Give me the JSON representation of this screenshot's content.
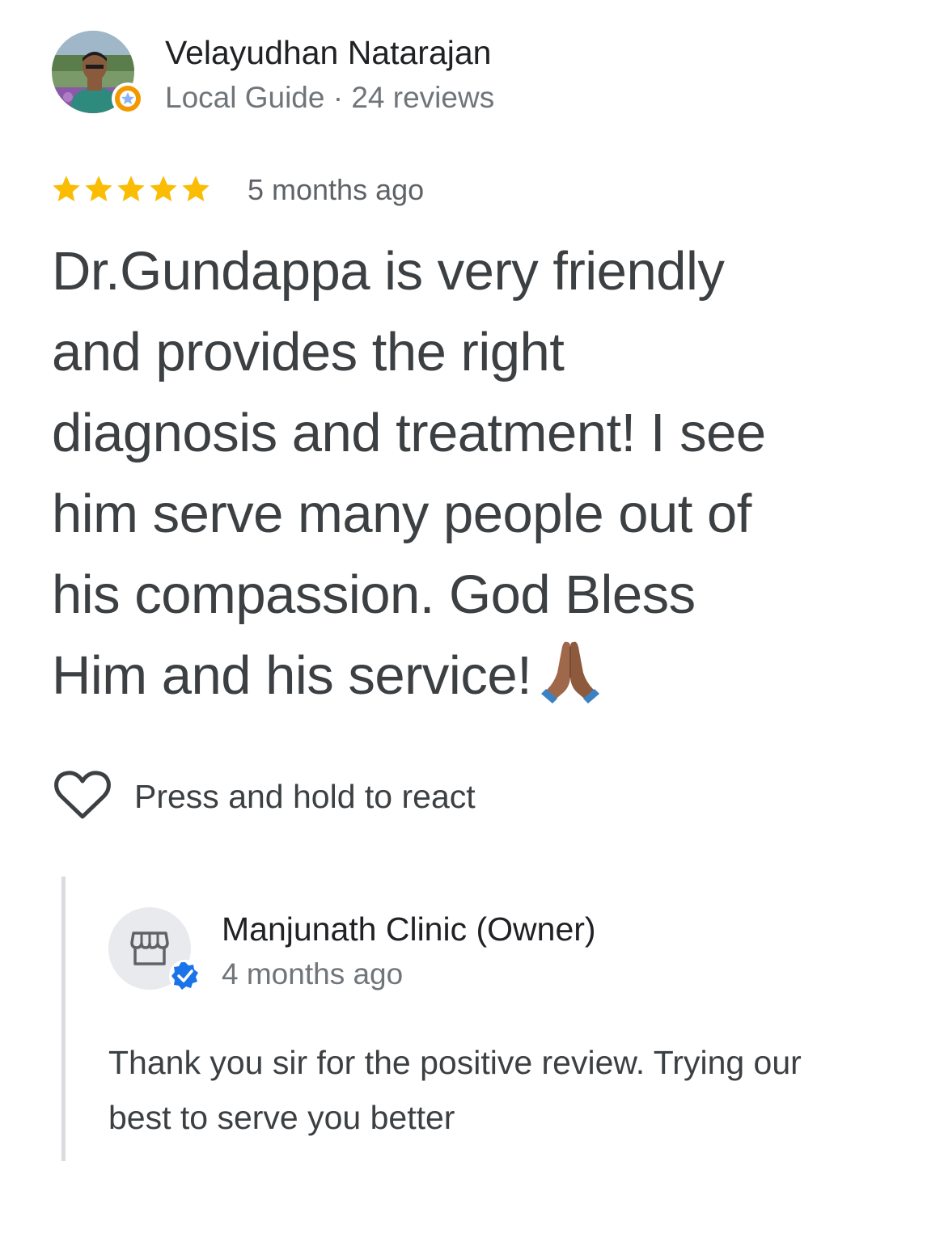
{
  "reviewer": {
    "name": "Velayudhan Natarajan",
    "meta": "Local Guide · 24 reviews"
  },
  "review": {
    "rating": 5,
    "rating_max": 5,
    "time": "5 months ago",
    "lines": [
      "Dr.Gundappa is very friendly",
      "and provides the right",
      "diagnosis and treatment!  I see",
      "him serve many people out of",
      "his compassion. God Bless",
      "Him and his service!"
    ],
    "emoji": "folded-hands-emoji"
  },
  "react": {
    "label": "Press and hold to react",
    "icon": "heart-outline-icon"
  },
  "owner_reply": {
    "name": "Manjunath Clinic (Owner)",
    "time": "4 months ago",
    "lines": [
      "Thank you sir for the positive review. Trying our",
      "best to serve you better"
    ],
    "avatar_icon": "storefront-icon",
    "badge_icon": "verified-check-icon"
  },
  "colors": {
    "star": "#fbbc04",
    "verified": "#1a73e8",
    "text_primary": "#202124",
    "text_secondary": "#70757a",
    "divider": "#dadce0"
  }
}
